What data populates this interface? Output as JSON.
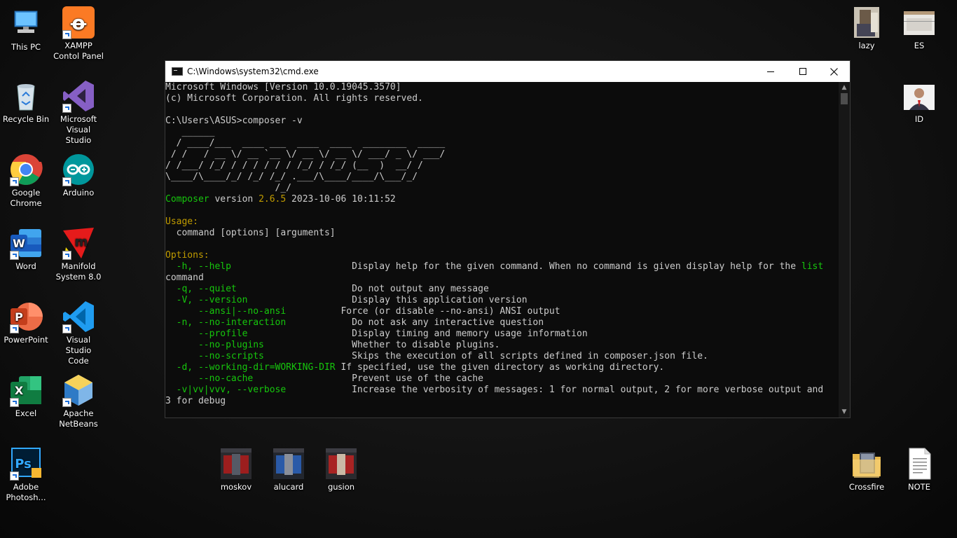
{
  "desktop": {
    "left_icons": [
      {
        "label": "This PC",
        "icon": "this-pc-icon"
      },
      {
        "label": "XAMPP\nContol Panel",
        "icon": "xampp-icon"
      },
      {
        "label": "Recycle Bin",
        "icon": "recycle-bin-icon"
      },
      {
        "label": "Microsoft\nVisual Studio",
        "icon": "visual-studio-icon"
      },
      {
        "label": "Google\nChrome",
        "icon": "chrome-icon"
      },
      {
        "label": "Arduino",
        "icon": "arduino-icon"
      },
      {
        "label": "Word",
        "icon": "word-icon"
      },
      {
        "label": "Manifold\nSystem 8.0",
        "icon": "manifold-icon"
      },
      {
        "label": "PowerPoint",
        "icon": "powerpoint-icon"
      },
      {
        "label": "Visual Studio\nCode",
        "icon": "vscode-icon"
      },
      {
        "label": "Excel",
        "icon": "excel-icon"
      },
      {
        "label": "Apache\nNetBeans",
        "icon": "netbeans-icon"
      },
      {
        "label": "Adobe\nPhotosh...",
        "icon": "photoshop-icon"
      }
    ],
    "right_icons": [
      {
        "label": "lazy",
        "icon": "image-file-icon"
      },
      {
        "label": "ES",
        "icon": "image-file-icon"
      },
      {
        "label": "ID",
        "icon": "image-file-icon"
      },
      {
        "label": "Crossfire",
        "icon": "folder-icon"
      },
      {
        "label": "NOTE",
        "icon": "text-file-icon"
      }
    ],
    "bottom_icons": [
      {
        "label": "moskov",
        "icon": "image-file-icon"
      },
      {
        "label": "alucard",
        "icon": "image-file-icon"
      },
      {
        "label": "gusion",
        "icon": "image-file-icon"
      }
    ]
  },
  "cmd_window": {
    "title": "C:\\Windows\\system32\\cmd.exe",
    "lines": [
      [
        {
          "t": "Microsoft Windows [Version 10.0.19045.3570]",
          "c": ""
        }
      ],
      [
        {
          "t": "(c) Microsoft Corporation. All rights reserved.",
          "c": ""
        }
      ],
      [
        {
          "t": "",
          "c": ""
        }
      ],
      [
        {
          "t": "C:\\Users\\ASUS>composer -v",
          "c": ""
        }
      ],
      [
        {
          "t": "   ______",
          "c": ""
        }
      ],
      [
        {
          "t": "  / ____/___  ____ ___  ____  ____  ________  _____",
          "c": ""
        }
      ],
      [
        {
          "t": " / /   / __ \\/ __ `__ \\/ __ \\/ __ \\/ ___/ _ \\/ ___/",
          "c": ""
        }
      ],
      [
        {
          "t": "/ /___/ /_/ / / / / / / /_/ / /_/ (__  )  __/ /",
          "c": ""
        }
      ],
      [
        {
          "t": "\\____/\\____/_/ /_/ /_/ .___/\\____/____/\\___/_/",
          "c": ""
        }
      ],
      [
        {
          "t": "                    /_/",
          "c": ""
        }
      ],
      [
        {
          "t": "Composer",
          "c": "green"
        },
        {
          "t": " version ",
          "c": ""
        },
        {
          "t": "2.6.5",
          "c": "yellow"
        },
        {
          "t": " 2023-10-06 10:11:52",
          "c": ""
        }
      ],
      [
        {
          "t": "",
          "c": ""
        }
      ],
      [
        {
          "t": "Usage:",
          "c": "yellow"
        }
      ],
      [
        {
          "t": "  command [options] [arguments]",
          "c": ""
        }
      ],
      [
        {
          "t": "",
          "c": ""
        }
      ],
      [
        {
          "t": "Options:",
          "c": "yellow"
        }
      ],
      [
        {
          "t": "  -h, --help",
          "c": "green"
        },
        {
          "t": "                      Display help for the given command. When no command is given display help for the ",
          "c": ""
        },
        {
          "t": "list",
          "c": "green"
        }
      ],
      [
        {
          "t": "command",
          "c": ""
        }
      ],
      [
        {
          "t": "  -q, --quiet",
          "c": "green"
        },
        {
          "t": "                     Do not output any message",
          "c": ""
        }
      ],
      [
        {
          "t": "  -V, --version",
          "c": "green"
        },
        {
          "t": "                   Display this application version",
          "c": ""
        }
      ],
      [
        {
          "t": "      --ansi|--no-ansi",
          "c": "green"
        },
        {
          "t": "          Force (or disable --no-ansi) ANSI output",
          "c": ""
        }
      ],
      [
        {
          "t": "  -n, --no-interaction",
          "c": "green"
        },
        {
          "t": "            Do not ask any interactive question",
          "c": ""
        }
      ],
      [
        {
          "t": "      --profile",
          "c": "green"
        },
        {
          "t": "                   Display timing and memory usage information",
          "c": ""
        }
      ],
      [
        {
          "t": "      --no-plugins",
          "c": "green"
        },
        {
          "t": "                Whether to disable plugins.",
          "c": ""
        }
      ],
      [
        {
          "t": "      --no-scripts",
          "c": "green"
        },
        {
          "t": "                Skips the execution of all scripts defined in composer.json file.",
          "c": ""
        }
      ],
      [
        {
          "t": "  -d, --working-dir=WORKING-DIR",
          "c": "green"
        },
        {
          "t": " If specified, use the given directory as working directory.",
          "c": ""
        }
      ],
      [
        {
          "t": "      --no-cache",
          "c": "green"
        },
        {
          "t": "                  Prevent use of the cache",
          "c": ""
        }
      ],
      [
        {
          "t": "  -v|vv|vvv, --verbose",
          "c": "green"
        },
        {
          "t": "            Increase the verbosity of messages: 1 for normal output, 2 for more verbose output and",
          "c": ""
        }
      ],
      [
        {
          "t": "3 for debug",
          "c": ""
        }
      ]
    ]
  }
}
